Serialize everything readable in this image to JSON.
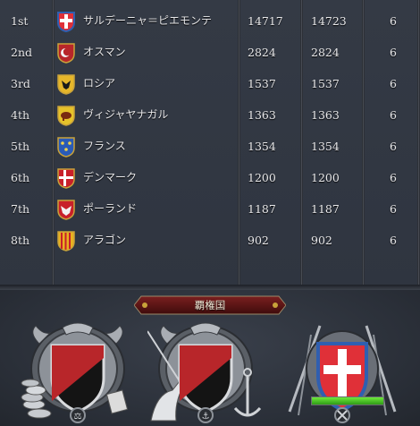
{
  "rankings": [
    {
      "rank": "1st",
      "name": "サルデーニャ＝ピエモンテ",
      "score_1": "14717",
      "score_2": "14723",
      "count": "6",
      "flag": "savoy-cross"
    },
    {
      "rank": "2nd",
      "name": "オスマン",
      "score_1": "2824",
      "score_2": "2824",
      "count": "6",
      "flag": "crescent-moon"
    },
    {
      "rank": "3rd",
      "name": "ロシア",
      "score_1": "1537",
      "score_2": "1537",
      "count": "6",
      "flag": "double-eagle"
    },
    {
      "rank": "4th",
      "name": "ヴィジャヤナガル",
      "score_1": "1363",
      "score_2": "1363",
      "count": "6",
      "flag": "elephant"
    },
    {
      "rank": "5th",
      "name": "フランス",
      "score_1": "1354",
      "score_2": "1354",
      "count": "6",
      "flag": "fleur-de-lis"
    },
    {
      "rank": "6th",
      "name": "デンマーク",
      "score_1": "1200",
      "score_2": "1200",
      "count": "6",
      "flag": "dannebrog"
    },
    {
      "rank": "7th",
      "name": "ポーランド",
      "score_1": "1187",
      "score_2": "1187",
      "count": "6",
      "flag": "white-eagle"
    },
    {
      "rank": "8th",
      "name": "アラゴン",
      "score_1": "902",
      "score_2": "902",
      "count": "6",
      "flag": "aragon-stripes"
    }
  ],
  "hegemon": {
    "title": "覇権国",
    "slots": [
      {
        "type": "economic",
        "shield": "red-black-diagonal",
        "icon": "money-coins-icon"
      },
      {
        "type": "naval",
        "shield": "red-black-diagonal",
        "icon": "anchor-unicorn-icon"
      },
      {
        "type": "military",
        "shield": "savoy-cross",
        "icon": "crossed-swords-icon",
        "progress": 1.0
      }
    ]
  },
  "colors": {
    "red": "#b8262a",
    "black": "#141414",
    "gold": "#c9a23a",
    "panel": "#2f3540"
  }
}
